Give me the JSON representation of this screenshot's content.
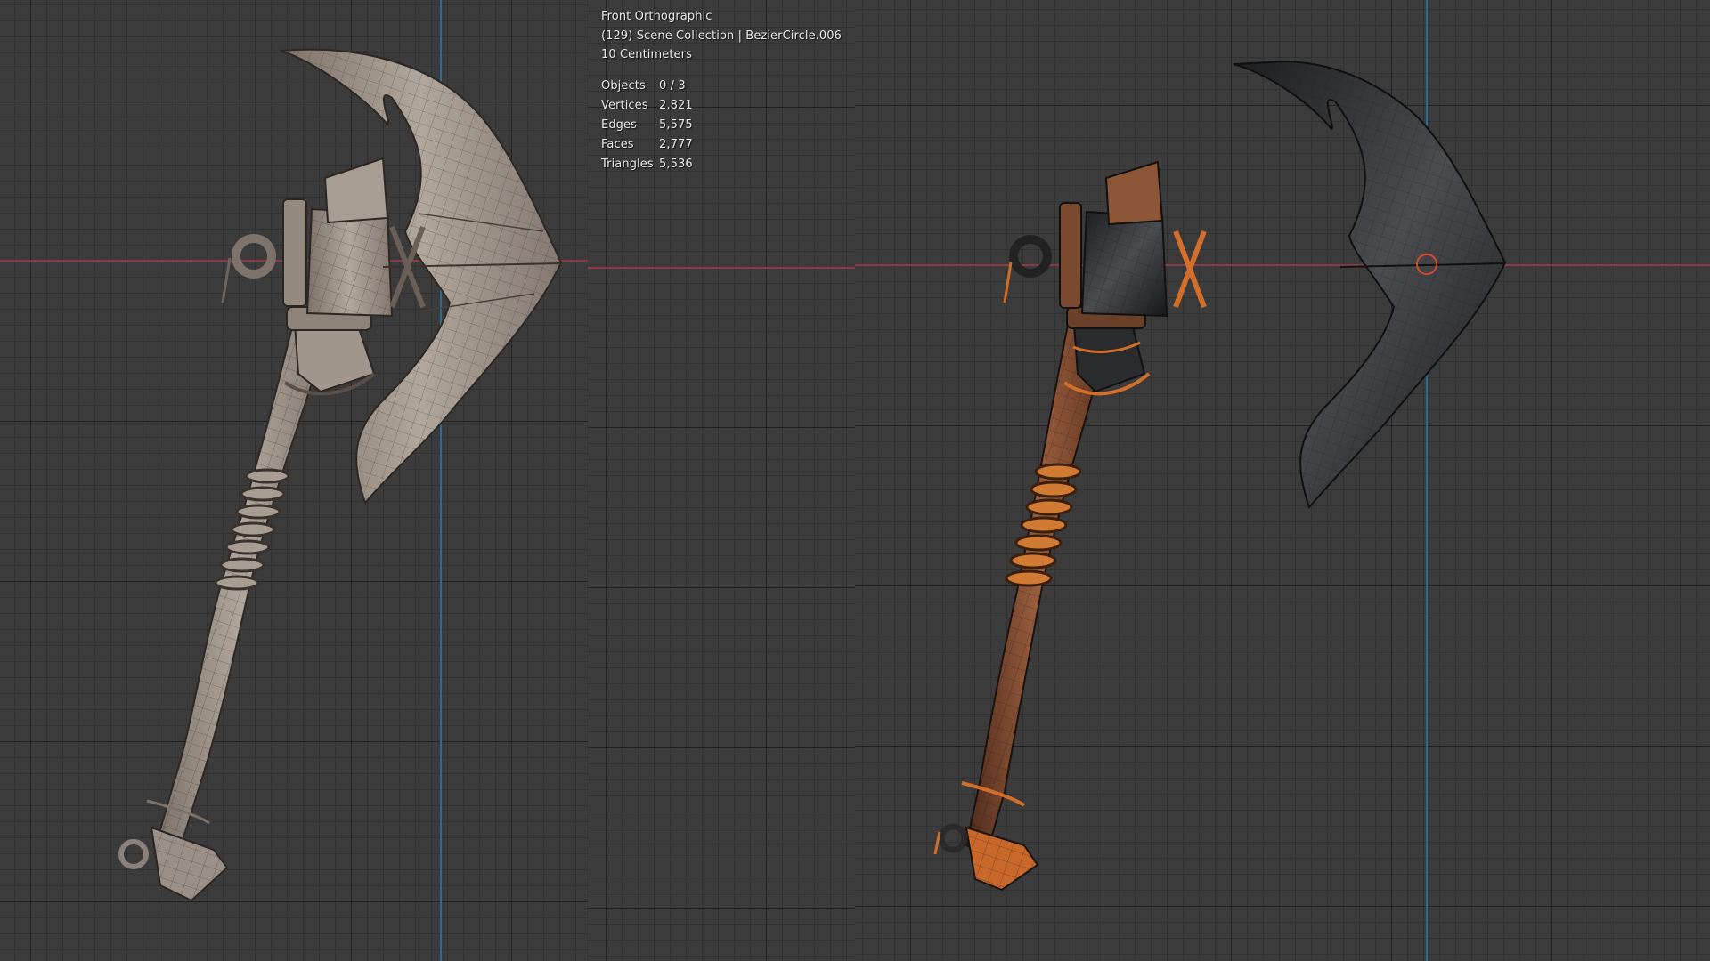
{
  "viewport": {
    "view_name": "Front Orthographic",
    "collection_line": "(129) Scene Collection | BezierCircle.006",
    "grid_scale": "10 Centimeters"
  },
  "stats": [
    {
      "label": "Objects",
      "value": "0 / 3"
    },
    {
      "label": "Vertices",
      "value": "2,821"
    },
    {
      "label": "Edges",
      "value": "5,575"
    },
    {
      "label": "Faces",
      "value": "2,777"
    },
    {
      "label": "Triangles",
      "value": "5,536"
    }
  ],
  "colors": {
    "background": "#3b3b3b",
    "x_axis": "#8a3a44",
    "y_axis": "#2c6b96",
    "clay": "#9a8e83",
    "wood": "#7a4a32",
    "rope": "#c86a2a",
    "metal": "#2a2c2e"
  },
  "views": [
    {
      "shading": "solid-wireframe"
    },
    {
      "shading": "textured-wireframe"
    }
  ]
}
